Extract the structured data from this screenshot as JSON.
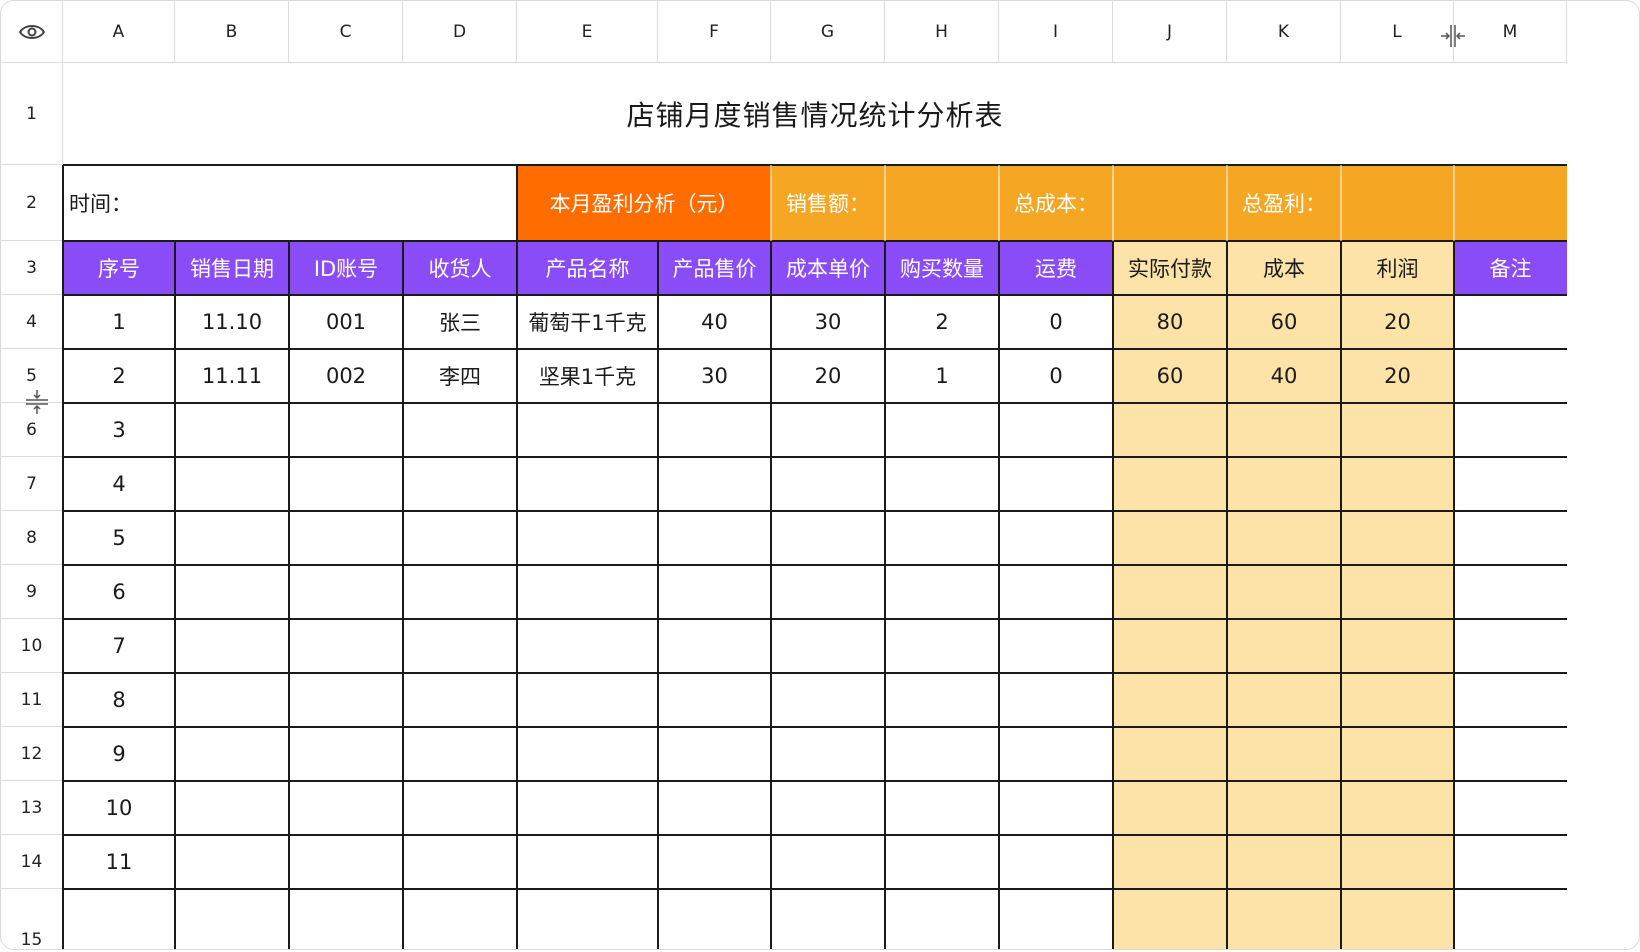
{
  "columns": [
    "A",
    "B",
    "C",
    "D",
    "E",
    "F",
    "G",
    "H",
    "I",
    "J",
    "K",
    "L",
    "M"
  ],
  "rows": [
    "1",
    "2",
    "3",
    "4",
    "5",
    "6",
    "7",
    "8",
    "9",
    "10",
    "11",
    "12",
    "13",
    "14",
    "15"
  ],
  "title": "店铺月度销售情况统计分析表",
  "summary": {
    "time_label": "时间：",
    "profit_analysis_label": "本月盈利分析（元）",
    "sales_label": "销售额：",
    "sales_value": "",
    "total_cost_label": "总成本：",
    "total_cost_value": "",
    "total_profit_label": "总盈利：",
    "total_profit_value": "",
    "extra_value": ""
  },
  "headers": [
    "序号",
    "销售日期",
    "ID账号",
    "收货人",
    "产品名称",
    "产品售价",
    "成本单价",
    "购买数量",
    "运费",
    "实际付款",
    "成本",
    "利润",
    "备注"
  ],
  "data_rows": [
    [
      "1",
      "11.10",
      "001",
      "张三",
      "葡萄干1千克",
      "40",
      "30",
      "2",
      "0",
      "80",
      "60",
      "20",
      ""
    ],
    [
      "2",
      "11.11",
      "002",
      "李四",
      "坚果1千克",
      "30",
      "20",
      "1",
      "0",
      "60",
      "40",
      "20",
      ""
    ],
    [
      "3",
      "",
      "",
      "",
      "",
      "",
      "",
      "",
      "",
      "",
      "",
      "",
      ""
    ],
    [
      "4",
      "",
      "",
      "",
      "",
      "",
      "",
      "",
      "",
      "",
      "",
      "",
      ""
    ],
    [
      "5",
      "",
      "",
      "",
      "",
      "",
      "",
      "",
      "",
      "",
      "",
      "",
      ""
    ],
    [
      "6",
      "",
      "",
      "",
      "",
      "",
      "",
      "",
      "",
      "",
      "",
      "",
      ""
    ],
    [
      "7",
      "",
      "",
      "",
      "",
      "",
      "",
      "",
      "",
      "",
      "",
      "",
      ""
    ],
    [
      "8",
      "",
      "",
      "",
      "",
      "",
      "",
      "",
      "",
      "",
      "",
      "",
      ""
    ],
    [
      "9",
      "",
      "",
      "",
      "",
      "",
      "",
      "",
      "",
      "",
      "",
      "",
      ""
    ],
    [
      "10",
      "",
      "",
      "",
      "",
      "",
      "",
      "",
      "",
      "",
      "",
      "",
      ""
    ],
    [
      "11",
      "",
      "",
      "",
      "",
      "",
      "",
      "",
      "",
      "",
      "",
      "",
      ""
    ]
  ],
  "colors": {
    "header_purple": "#8a4cf7",
    "profit_analysis_orange": "#ff6d00",
    "summary_orange": "#f5a623",
    "computed_column_fill": "#fde3a7",
    "grid": "#1a1a1a"
  },
  "icons": {
    "corner": "eye-icon",
    "column_resize": "column-resize-icon",
    "row_resize": "row-resize-icon"
  }
}
